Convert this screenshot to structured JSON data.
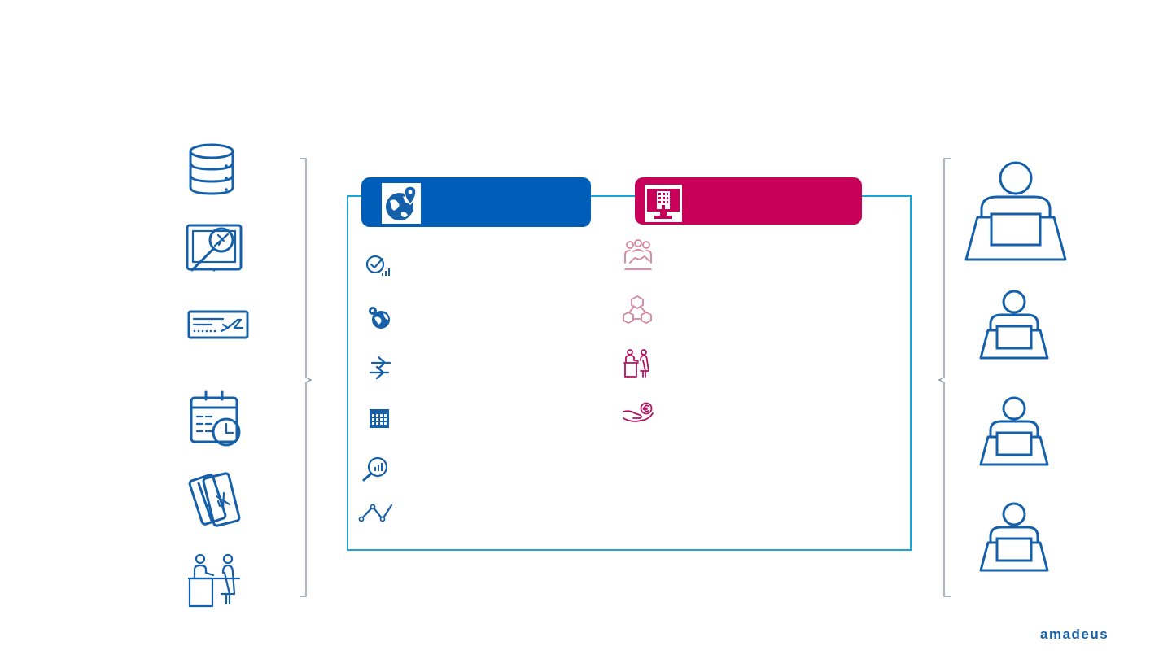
{
  "brand": {
    "logo_text": "amadeus",
    "primary": "#005eb8",
    "secondary": "#c8005a",
    "frame": "#1aa3d8"
  },
  "left_column": {
    "icons": [
      "database-icon",
      "tablet-flight-search-icon",
      "boarding-pass-icon",
      "calendar-clock-icon",
      "tickets-icon",
      "check-in-desk-icon"
    ]
  },
  "center": {
    "left_panel": {
      "header_icon": "globe-pin-icon",
      "items": [
        "checkmark-signal-icon",
        "globe-gear-icon",
        "plane-arrows-icon",
        "calendar-grid-icon",
        "magnifier-chart-icon",
        "line-chart-icon"
      ]
    },
    "right_panel": {
      "header_icon": "monitor-building-icon",
      "items": [
        "people-handshake-icon",
        "network-cubes-icon",
        "reception-desk-icon",
        "hand-euro-icon"
      ]
    }
  },
  "right_column": {
    "icons": [
      "user-laptop-icon",
      "user-laptop-icon",
      "user-laptop-icon",
      "user-laptop-icon"
    ]
  }
}
